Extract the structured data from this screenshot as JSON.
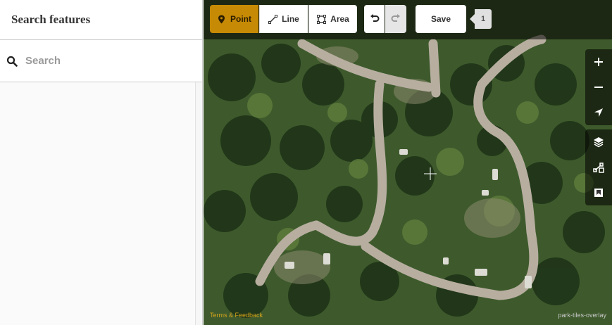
{
  "sidebar": {
    "title": "Search features",
    "search": {
      "placeholder": "Search",
      "value": "",
      "icon": "search-icon"
    }
  },
  "toolbar": {
    "point_label": "Point",
    "line_label": "Line",
    "area_label": "Area",
    "save_label": "Save",
    "save_count": "1",
    "active_mode": "point",
    "colors": {
      "accent": "#c68a05",
      "bar": "rgba(0,0,0,0.55)"
    },
    "icons": [
      "point-pin-icon",
      "line-icon",
      "area-icon",
      "undo-icon",
      "redo-icon"
    ]
  },
  "map_controls": {
    "icons": [
      "zoom-in-icon",
      "zoom-out-icon",
      "geolocate-icon",
      "layers-icon",
      "map-data-icon",
      "help-icon"
    ]
  },
  "footer": {
    "link_text": "Terms & Feedback",
    "attribution": "park-tiles-overlay"
  }
}
